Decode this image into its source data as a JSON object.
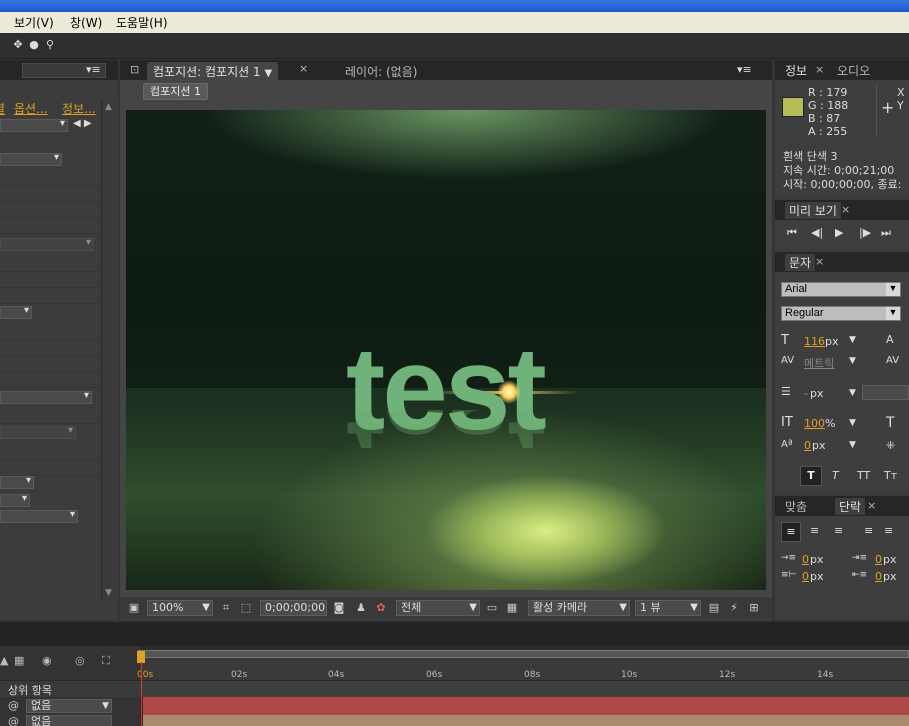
{
  "menu": {
    "view": "보기(V)",
    "window": "창(W)",
    "help": "도움말(H)"
  },
  "comp_panel": {
    "tab_label": "컴포지션: 컴포지션 1",
    "layer_tab": "레이어: (없음)",
    "comp_chip": "컴포지션 1",
    "zoom": "100%",
    "timecode": "0;00;00;00",
    "resolution": "전체",
    "camera": "활성 카메라",
    "views": "1 뷰"
  },
  "viewer": {
    "text": "test"
  },
  "left_panel": {
    "tabs": [
      "결",
      "옵션...",
      "정보..."
    ]
  },
  "info_panel": {
    "tab_info": "정보",
    "tab_audio": "오디오",
    "r": "R : 179",
    "g": "G : 188",
    "b": "B : 87",
    "a": "A : 255",
    "x": "X",
    "y": "Y",
    "layer": "흰색 단색 3",
    "duration": "지속 시간: 0;00;21;00",
    "start": "시작: 0;00;00;00, 종료:",
    "swatch_color": "#b3bc57"
  },
  "preview_panel": {
    "title": "미리 보기"
  },
  "character_panel": {
    "title": "문자",
    "font": "Arial",
    "style": "Regular",
    "size": "116",
    "size_unit": "px",
    "kerning": "메트릭",
    "leading": "-",
    "leading_unit": "px",
    "vscale": "100",
    "vscale_unit": "%",
    "baseline": "0",
    "baseline_unit": "px"
  },
  "paragraph_panel": {
    "tab_align": "맞춤",
    "tab_para": "단락",
    "indent_left": "0",
    "indent_right": "0",
    "indent_first": "0",
    "space_after": "0",
    "unit": "px"
  },
  "timeline": {
    "ticks": [
      "00s",
      "02s",
      "04s",
      "06s",
      "08s",
      "10s",
      "12s",
      "14s"
    ],
    "parent_header": "상위 항목",
    "parent_values": [
      "없음",
      "없음"
    ]
  },
  "colors": {
    "accent": "#e0a020",
    "viewer_text": "#6fb37a",
    "red_layer": "#b04848",
    "tan_layer": "#a98a6a"
  }
}
